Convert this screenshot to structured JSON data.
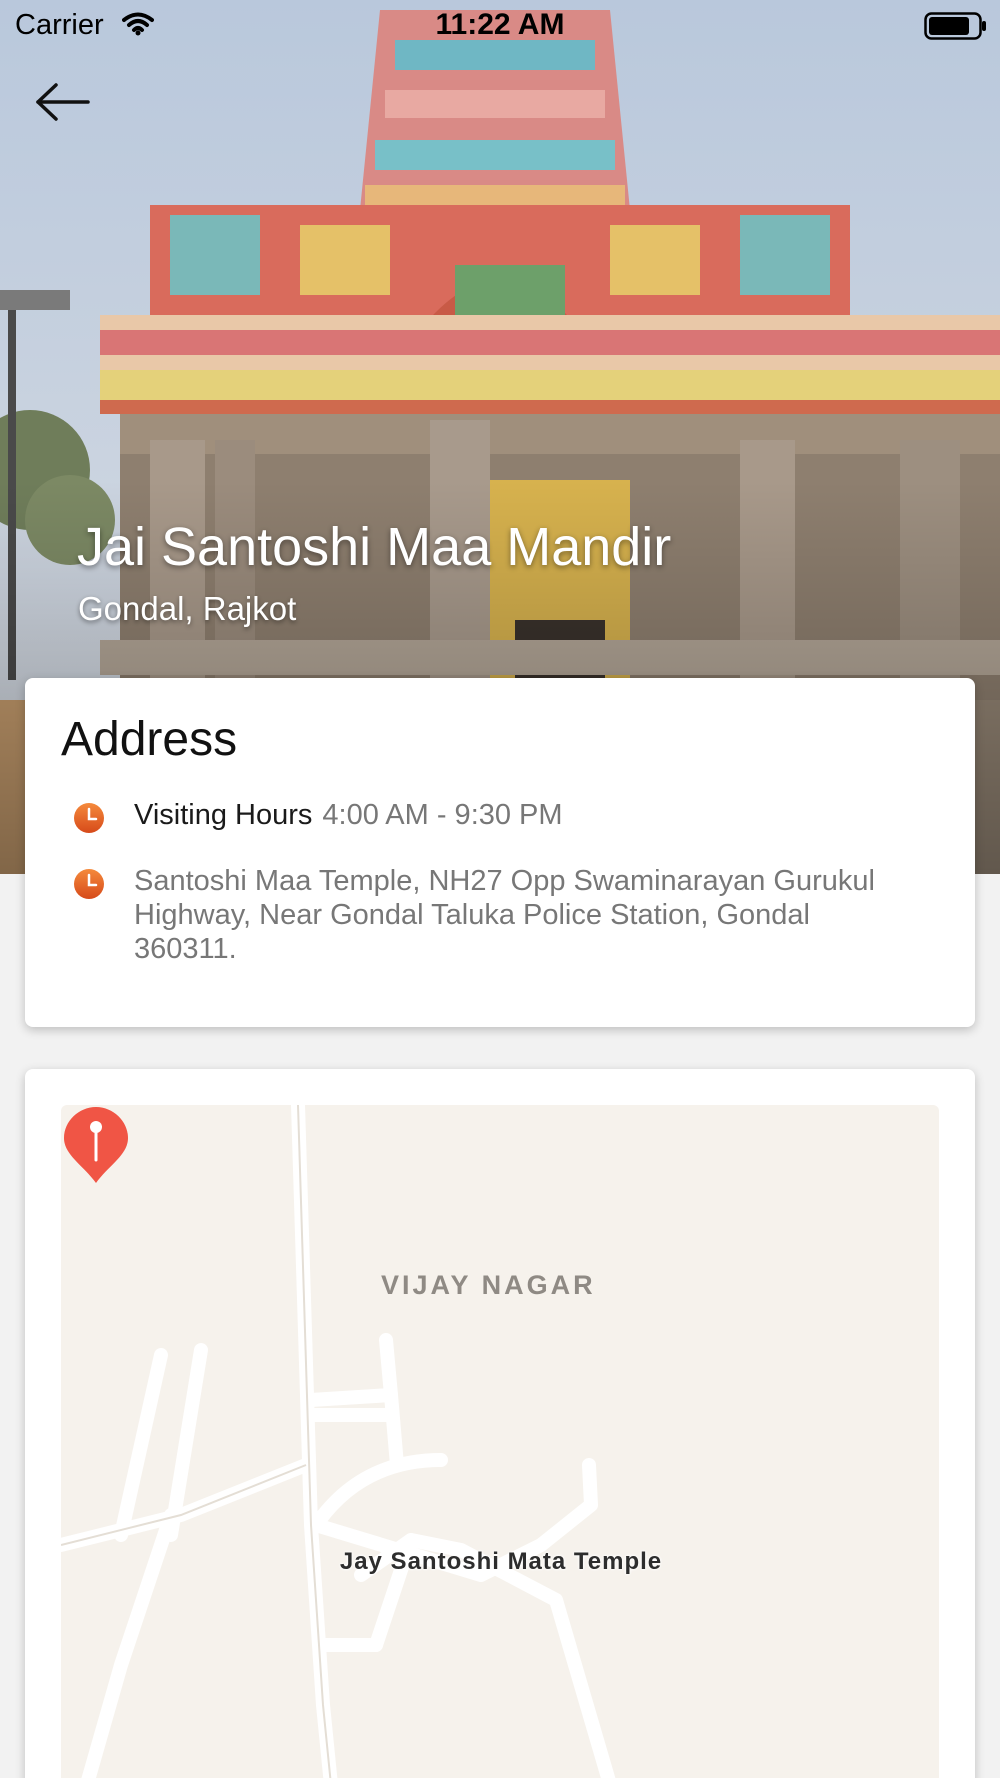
{
  "status_bar": {
    "carrier": "Carrier",
    "time": "11:22 AM"
  },
  "hero": {
    "title": "Jai Santoshi Maa Mandir",
    "subtitle": "Gondal, Rajkot"
  },
  "address_card": {
    "heading": "Address",
    "visiting_hours_label": "Visiting Hours",
    "visiting_hours_value": "4:00 AM - 9:30 PM",
    "address": "Santoshi Maa Temple, NH27 Opp Swaminarayan Gurukul Highway, Near Gondal Taluka Police Station, Gondal 360311."
  },
  "map": {
    "area_label": "VIJAY NAGAR",
    "place_label": "Jay Santoshi Mata Temple"
  },
  "icons": {
    "back": "arrow-left-icon",
    "clock": "clock-icon",
    "wifi": "wifi-icon",
    "battery": "battery-icon",
    "pin": "map-pin-icon"
  },
  "colors": {
    "accent": "#e8552a",
    "pin": "#f05545",
    "map_bg": "#f6f2ec"
  }
}
